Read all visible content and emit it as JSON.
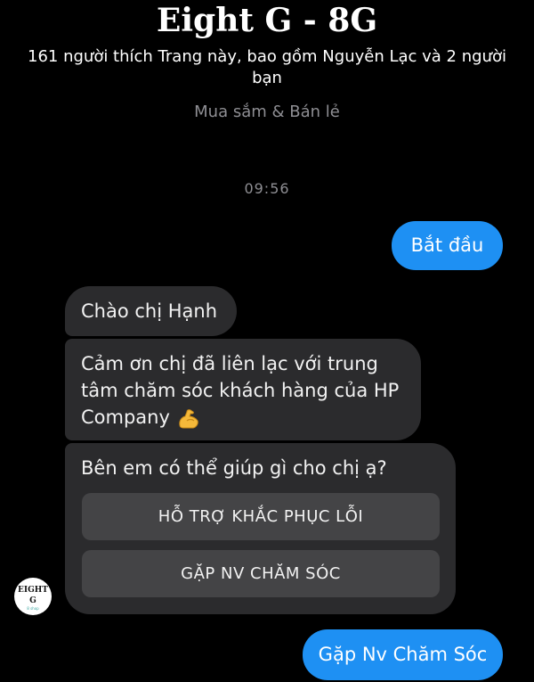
{
  "page": {
    "title": "Eight G - 8G",
    "likes_text": "161 người thích Trang này, bao gồm Nguyễn Lạc và 2 người bạn",
    "category": "Mua sắm & Bán lẻ"
  },
  "conversation": {
    "timestamp": "09:56",
    "messages": [
      {
        "from": "user",
        "text": "Bắt đầu"
      },
      {
        "from": "page",
        "text": "Chào chị Hạnh"
      },
      {
        "from": "page",
        "text": "Cảm ơn chị đã liên lạc với trung tâm chăm sóc khách hàng của HP Company",
        "emoji": "flexed-biceps-icon"
      },
      {
        "from": "page",
        "text": "Bên em có thể giúp gì cho chị ạ?",
        "quick_replies": [
          "HỖ TRỢ KHẮC PHỤC LỖI",
          "GẶP NV CHĂM SÓC"
        ]
      },
      {
        "from": "user",
        "text": "Gặp Nv Chăm Sóc"
      }
    ]
  },
  "avatar": {
    "logo_text": "EIGHT G",
    "sub_text": "8 shop"
  },
  "colors": {
    "background": "#000000",
    "outgoing_bubble": "#1e90f3",
    "incoming_bubble": "#2b2b2d",
    "quick_reply_button": "#444446",
    "muted_text": "#8e8e93"
  }
}
